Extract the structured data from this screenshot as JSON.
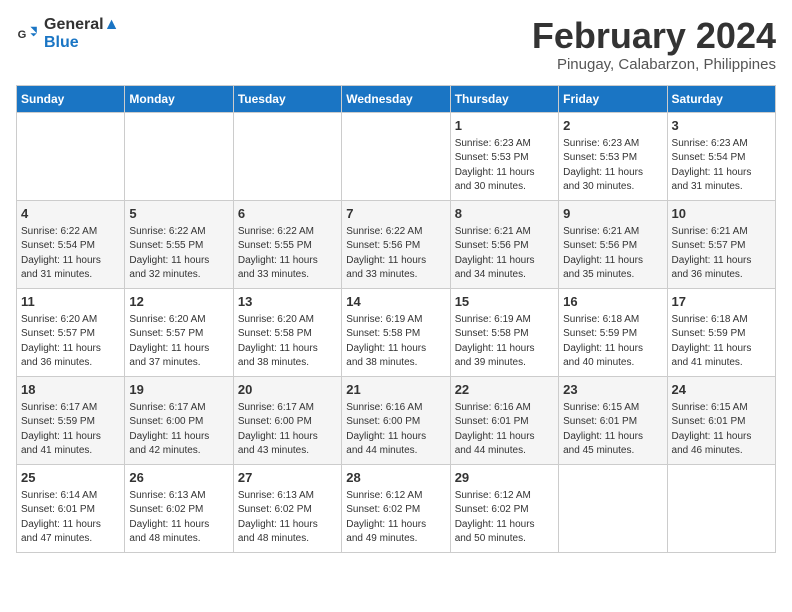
{
  "header": {
    "logo_line1": "General",
    "logo_line2": "Blue",
    "month_title": "February 2024",
    "location": "Pinugay, Calabarzon, Philippines"
  },
  "days_of_week": [
    "Sunday",
    "Monday",
    "Tuesday",
    "Wednesday",
    "Thursday",
    "Friday",
    "Saturday"
  ],
  "weeks": [
    [
      {
        "day": "",
        "info": ""
      },
      {
        "day": "",
        "info": ""
      },
      {
        "day": "",
        "info": ""
      },
      {
        "day": "",
        "info": ""
      },
      {
        "day": "1",
        "info": "Sunrise: 6:23 AM\nSunset: 5:53 PM\nDaylight: 11 hours\nand 30 minutes."
      },
      {
        "day": "2",
        "info": "Sunrise: 6:23 AM\nSunset: 5:53 PM\nDaylight: 11 hours\nand 30 minutes."
      },
      {
        "day": "3",
        "info": "Sunrise: 6:23 AM\nSunset: 5:54 PM\nDaylight: 11 hours\nand 31 minutes."
      }
    ],
    [
      {
        "day": "4",
        "info": "Sunrise: 6:22 AM\nSunset: 5:54 PM\nDaylight: 11 hours\nand 31 minutes."
      },
      {
        "day": "5",
        "info": "Sunrise: 6:22 AM\nSunset: 5:55 PM\nDaylight: 11 hours\nand 32 minutes."
      },
      {
        "day": "6",
        "info": "Sunrise: 6:22 AM\nSunset: 5:55 PM\nDaylight: 11 hours\nand 33 minutes."
      },
      {
        "day": "7",
        "info": "Sunrise: 6:22 AM\nSunset: 5:56 PM\nDaylight: 11 hours\nand 33 minutes."
      },
      {
        "day": "8",
        "info": "Sunrise: 6:21 AM\nSunset: 5:56 PM\nDaylight: 11 hours\nand 34 minutes."
      },
      {
        "day": "9",
        "info": "Sunrise: 6:21 AM\nSunset: 5:56 PM\nDaylight: 11 hours\nand 35 minutes."
      },
      {
        "day": "10",
        "info": "Sunrise: 6:21 AM\nSunset: 5:57 PM\nDaylight: 11 hours\nand 36 minutes."
      }
    ],
    [
      {
        "day": "11",
        "info": "Sunrise: 6:20 AM\nSunset: 5:57 PM\nDaylight: 11 hours\nand 36 minutes."
      },
      {
        "day": "12",
        "info": "Sunrise: 6:20 AM\nSunset: 5:57 PM\nDaylight: 11 hours\nand 37 minutes."
      },
      {
        "day": "13",
        "info": "Sunrise: 6:20 AM\nSunset: 5:58 PM\nDaylight: 11 hours\nand 38 minutes."
      },
      {
        "day": "14",
        "info": "Sunrise: 6:19 AM\nSunset: 5:58 PM\nDaylight: 11 hours\nand 38 minutes."
      },
      {
        "day": "15",
        "info": "Sunrise: 6:19 AM\nSunset: 5:58 PM\nDaylight: 11 hours\nand 39 minutes."
      },
      {
        "day": "16",
        "info": "Sunrise: 6:18 AM\nSunset: 5:59 PM\nDaylight: 11 hours\nand 40 minutes."
      },
      {
        "day": "17",
        "info": "Sunrise: 6:18 AM\nSunset: 5:59 PM\nDaylight: 11 hours\nand 41 minutes."
      }
    ],
    [
      {
        "day": "18",
        "info": "Sunrise: 6:17 AM\nSunset: 5:59 PM\nDaylight: 11 hours\nand 41 minutes."
      },
      {
        "day": "19",
        "info": "Sunrise: 6:17 AM\nSunset: 6:00 PM\nDaylight: 11 hours\nand 42 minutes."
      },
      {
        "day": "20",
        "info": "Sunrise: 6:17 AM\nSunset: 6:00 PM\nDaylight: 11 hours\nand 43 minutes."
      },
      {
        "day": "21",
        "info": "Sunrise: 6:16 AM\nSunset: 6:00 PM\nDaylight: 11 hours\nand 44 minutes."
      },
      {
        "day": "22",
        "info": "Sunrise: 6:16 AM\nSunset: 6:01 PM\nDaylight: 11 hours\nand 44 minutes."
      },
      {
        "day": "23",
        "info": "Sunrise: 6:15 AM\nSunset: 6:01 PM\nDaylight: 11 hours\nand 45 minutes."
      },
      {
        "day": "24",
        "info": "Sunrise: 6:15 AM\nSunset: 6:01 PM\nDaylight: 11 hours\nand 46 minutes."
      }
    ],
    [
      {
        "day": "25",
        "info": "Sunrise: 6:14 AM\nSunset: 6:01 PM\nDaylight: 11 hours\nand 47 minutes."
      },
      {
        "day": "26",
        "info": "Sunrise: 6:13 AM\nSunset: 6:02 PM\nDaylight: 11 hours\nand 48 minutes."
      },
      {
        "day": "27",
        "info": "Sunrise: 6:13 AM\nSunset: 6:02 PM\nDaylight: 11 hours\nand 48 minutes."
      },
      {
        "day": "28",
        "info": "Sunrise: 6:12 AM\nSunset: 6:02 PM\nDaylight: 11 hours\nand 49 minutes."
      },
      {
        "day": "29",
        "info": "Sunrise: 6:12 AM\nSunset: 6:02 PM\nDaylight: 11 hours\nand 50 minutes."
      },
      {
        "day": "",
        "info": ""
      },
      {
        "day": "",
        "info": ""
      }
    ]
  ]
}
